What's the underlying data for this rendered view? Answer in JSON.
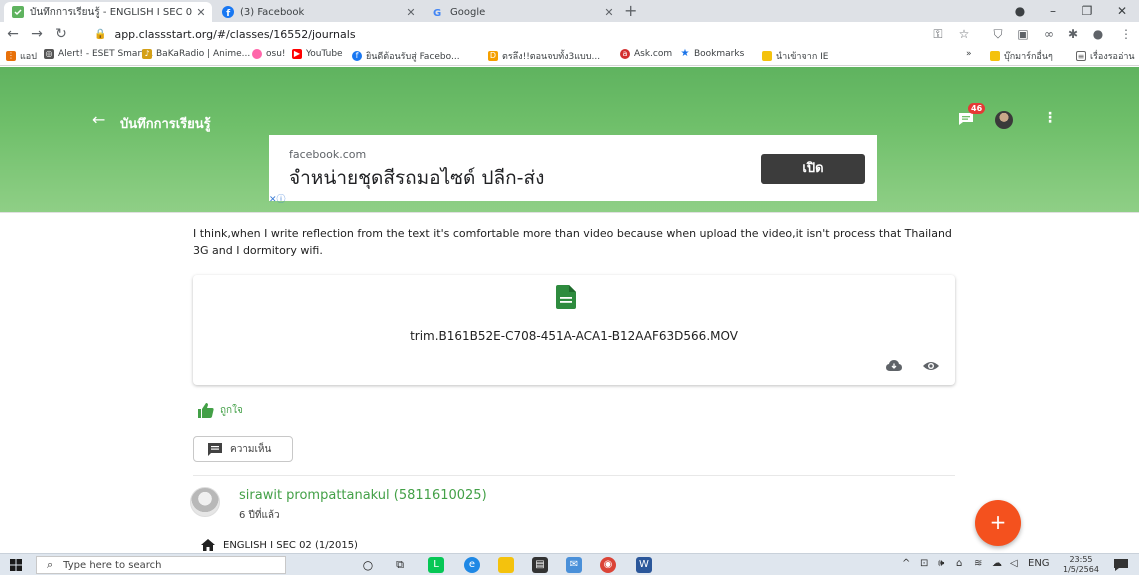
{
  "browser": {
    "tabs": [
      {
        "title": "บันทึกการเรียนรู้ - ENGLISH I SEC 0",
        "active": true
      },
      {
        "title": "(3) Facebook",
        "active": false
      },
      {
        "title": "Google",
        "active": false
      }
    ],
    "url": "app.classstart.org/#/classes/16552/journals",
    "bookmarks": [
      "แอป",
      "Alert! - ESET Smart...",
      "BaKaRadio | Anime...",
      "osu!",
      "YouTube",
      "ยินดีต้อนรับสู่ Facebo...",
      "ตรลึง!!ตอนจบทั้ง3แบบ...",
      "Ask.com",
      "Bookmarks",
      "นำเข้าจาก IE",
      "»",
      "บุ๊กมาร์กอื่นๆ",
      "เรื่องรออ่าน"
    ]
  },
  "appbar": {
    "title": "บันทึกการเรียนรู้",
    "notification_count": "46"
  },
  "ad": {
    "domain": "facebook.com",
    "headline": "จำหน่ายชุดสีรถมอไซด์ ปลีก-ส่ง",
    "cta": "เปิด"
  },
  "journal": {
    "reflection": "I think,when I write reflection from the text it's comfortable more than video because when upload the video,it isn't process that Thailand 3G and I dormitory wifi.",
    "attachment": {
      "filename": "trim.B161B52E-C708-451A-ACA1-B12AAF63D566.MOV"
    },
    "like_label": "ถูกใจ",
    "comment_label": "ความเห็น",
    "author": {
      "name": "sirawit prompattanakul (5811610025)",
      "time": "6 ปีที่แล้ว"
    },
    "course": "ENGLISH I SEC 02 (1/2015)"
  },
  "fab": {
    "label": "+"
  },
  "taskbar": {
    "search_placeholder": "Type here to search",
    "language": "ENG",
    "time": "23:55",
    "date": "1/5/2564"
  },
  "colors": {
    "primary_green": "#5fb35f",
    "accent_orange": "#f4511e",
    "link_green": "#43a047",
    "file_icon_green": "#2e8b3e"
  }
}
